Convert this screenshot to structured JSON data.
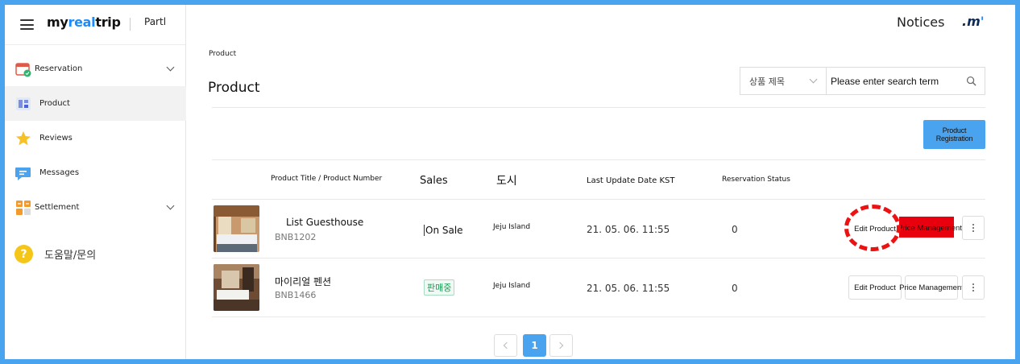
{
  "brand": {
    "logo_part1": "my",
    "logo_part2": "real",
    "logo_part3": "trip",
    "partner": "Partl"
  },
  "header": {
    "notices": "Notices",
    "mini_logo": ".m",
    "mini_logo_accent": "'"
  },
  "sidebar": {
    "items": [
      {
        "label": "Reservation",
        "icon": "calendar-icon",
        "expandable": true
      },
      {
        "label": "Product",
        "icon": "product-icon",
        "active": true
      },
      {
        "label": "Reviews",
        "icon": "star-icon"
      },
      {
        "label": "Messages",
        "icon": "message-icon"
      },
      {
        "label": "Settlement",
        "icon": "settlement-icon",
        "expandable": true
      }
    ],
    "help": {
      "icon_text": "?",
      "label": "도움말/문의"
    }
  },
  "main": {
    "breadcrumb": "Product",
    "title": "Product",
    "search": {
      "select_value": "상품 제목",
      "placeholder": "Please enter search term"
    },
    "register_button": "Product Registration",
    "columns": {
      "title": "Product Title / Product Number",
      "sales": "Sales",
      "city": "도시",
      "updated": "Last Update Date KST",
      "reservation": "Reservation Status"
    },
    "rows": [
      {
        "name": "List Guesthouse",
        "number": "BNB1202",
        "sales": "On Sale",
        "city": "Jeju Island",
        "updated": "21. 05. 06. 11:55",
        "reservations": "0",
        "edit": "Edit Product",
        "price": "Price Management"
      },
      {
        "name": "마이리얼 펜션",
        "number": "BNB1466",
        "sales": "판매중",
        "city": "Jeju Island",
        "updated": "21. 05. 06. 11:55",
        "reservations": "0",
        "edit": "Edit Product",
        "price": "Price Management"
      }
    ],
    "pagination": {
      "current": "1"
    }
  },
  "colors": {
    "accent": "#4aa3ee",
    "brand_blue": "#1a8cff",
    "annotation_red": "#e8000f",
    "on_sale_green": "#1a9a55"
  }
}
